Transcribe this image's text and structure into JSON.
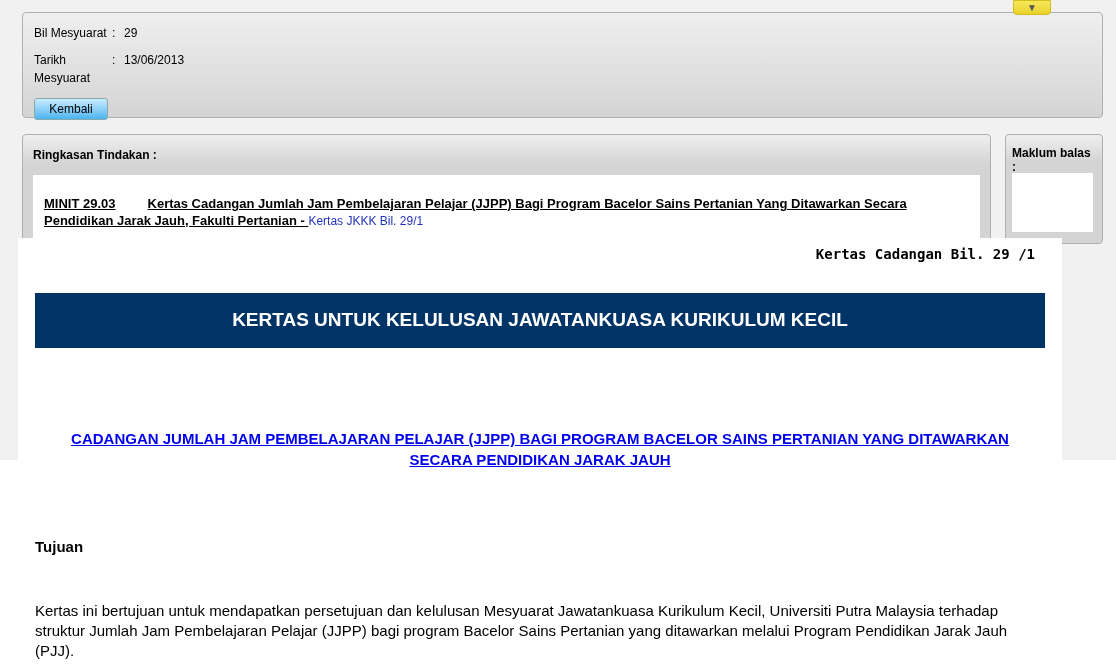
{
  "meeting": {
    "fields": [
      {
        "label": "Bil Mesyuarat",
        "separator": ":",
        "value": "29"
      },
      {
        "label": "Tarikh Mesyuarat",
        "separator": ":",
        "value": "13/06/2013"
      }
    ],
    "back_button": "Kembali",
    "toggle": "▼"
  },
  "summary": {
    "title": "Ringkasan Tindakan :",
    "minute_no": "MINIT 29.03",
    "minute_title": "Kertas Cadangan Jumlah Jam Pembelajaran Pelajar (JJPP) Bagi Program Bacelor Sains Pertanian Yang Ditawarkan Secara Pendidikan Jarak Jauh, Fakulti Pertanian  - ",
    "paper_link": "Kertas JKKK Bil. 29/1"
  },
  "feedback": {
    "title": "Maklum balas :"
  },
  "document": {
    "reference": "Kertas Cadangan Bil. 29 /1",
    "banner": "KERTAS UNTUK KELULUSAN JAWATANKUASA KURIKULUM KECIL",
    "heading": "CADANGAN JUMLAH JAM PEMBELAJARAN PELAJAR (JJPP) BAGI PROGRAM BACELOR SAINS PERTANIAN YANG DITAWARKAN SECARA PENDIDIKAN JARAK JAUH",
    "section_title": "Tujuan",
    "paragraph": "Kertas ini bertujuan untuk mendapatkan persetujuan dan kelulusan Mesyuarat Jawatankuasa Kurikulum Kecil, Universiti Putra Malaysia terhadap struktur Jumlah Jam Pembelajaran Pelajar (JJPP) bagi program Bacelor Sains Pertanian yang ditawarkan melalui Program Pendidikan Jarak Jauh (PJJ)."
  }
}
